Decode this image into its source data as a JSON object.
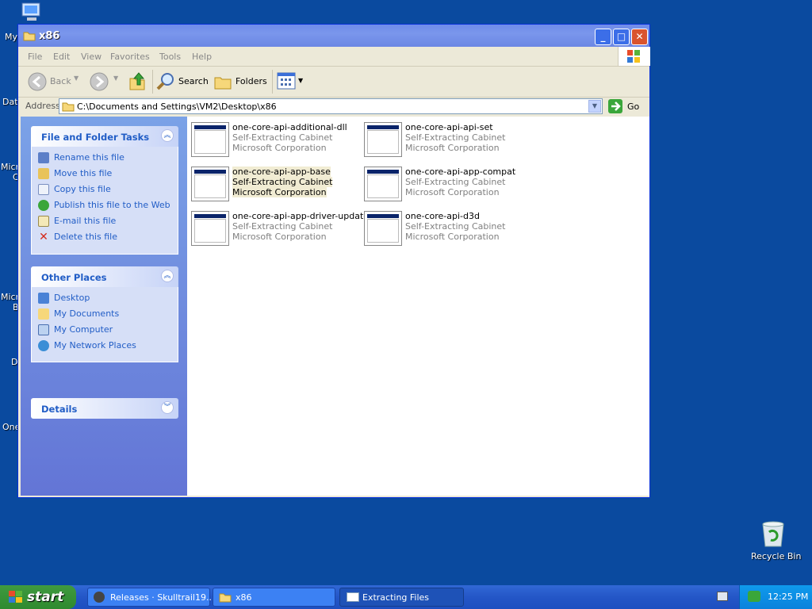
{
  "desktop": {
    "icons_left": [
      {
        "label": "My"
      },
      {
        "label": "Dat"
      },
      {
        "label": "Micro"
      },
      {
        "label": "C"
      },
      {
        "label": "Micro"
      },
      {
        "label": "B"
      },
      {
        "label": "D"
      },
      {
        "label": "One"
      }
    ],
    "recycle_bin": {
      "label": "Recycle Bin"
    }
  },
  "window": {
    "title": "x86",
    "menu": [
      "File",
      "Edit",
      "View",
      "Favorites",
      "Tools",
      "Help"
    ],
    "toolbar": {
      "back": "Back",
      "search": "Search",
      "folders": "Folders"
    },
    "address": {
      "label": "Address",
      "value": "C:\\Documents and Settings\\VM2\\Desktop\\x86",
      "go": "Go"
    }
  },
  "sidepane": {
    "file_tasks": {
      "title": "File and Folder Tasks",
      "items": [
        "Rename this file",
        "Move this file",
        "Copy this file",
        "Publish this file to the Web",
        "E-mail this file",
        "Delete this file"
      ]
    },
    "other_places": {
      "title": "Other Places",
      "items": [
        "Desktop",
        "My Documents",
        "My Computer",
        "My Network Places"
      ]
    },
    "details": {
      "title": "Details"
    }
  },
  "files": [
    {
      "name": "one-core-api-additional-dll",
      "type": "Self-Extracting Cabinet",
      "company": "Microsoft Corporation"
    },
    {
      "name": "one-core-api-api-set",
      "type": "Self-Extracting Cabinet",
      "company": "Microsoft Corporation"
    },
    {
      "name": "one-core-api-app-base",
      "type": "Self-Extracting Cabinet",
      "company": "Microsoft Corporation"
    },
    {
      "name": "one-core-api-app-compat",
      "type": "Self-Extracting Cabinet",
      "company": "Microsoft Corporation"
    },
    {
      "name": "one-core-api-app-driver-update",
      "type": "Self-Extracting Cabinet",
      "company": "Microsoft Corporation"
    },
    {
      "name": "one-core-api-d3d",
      "type": "Self-Extracting Cabinet",
      "company": "Microsoft Corporation"
    }
  ],
  "taskbar": {
    "start": "start",
    "items": [
      {
        "label": "Releases · Skulltrail19..."
      },
      {
        "label": "x86"
      },
      {
        "label": "Extracting Files"
      }
    ],
    "clock": "12:25 PM"
  }
}
